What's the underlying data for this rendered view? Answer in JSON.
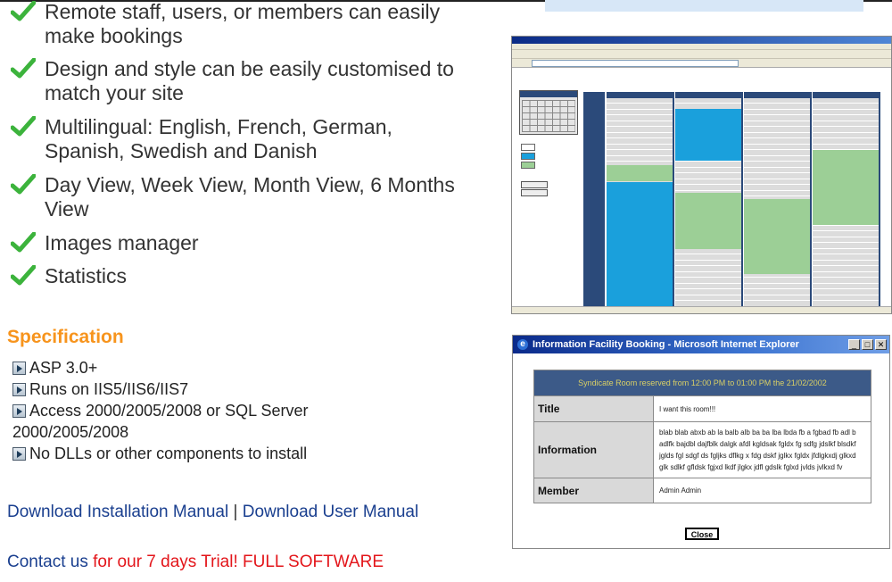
{
  "features": [
    {
      "text": "Remote staff, users, or members can easily make bookings"
    },
    {
      "text": "Design and style can be easily customised to match your site"
    },
    {
      "text": "Multilingual: English, French, German, Spanish, Swedish and Danish"
    },
    {
      "text": "Day View, Week View, Month View, 6 Months View"
    },
    {
      "text": "Images manager"
    },
    {
      "text": "Statistics"
    }
  ],
  "specification": {
    "title": "Specification",
    "items": [
      "ASP 3.0+",
      "Runs on IIS5/IIS6/IIS7",
      "Access 2000/2005/2008 or SQL Server 2000/2005/2008",
      "No DLLs or other components to install"
    ]
  },
  "links": {
    "install_manual": "Download Installation Manual",
    "separator": "|",
    "user_manual": "Download User Manual"
  },
  "contact": {
    "link": "Contact us",
    "trial": " for our 7 days Trial! FULL SOFTWARE"
  },
  "dialog": {
    "window_title": "Information Facility Booking - Microsoft Internet Explorer",
    "banner": "Syndicate Room reserved from 12:00 PM to 01:00 PM the 21/02/2002",
    "title_label": "Title",
    "title_value": "I want this room!!!",
    "info_label": "Information",
    "info_value": "blab blab abxb ab la balb alb ba ba lba lbda fb a fgbad fb adl b adlfk bajdbl dajfblk dalgk afdl kgldsak fgldx fg sdfg jdslkf blsdkf jglds fgl sdgf ds fgljks dflkg x fdg dskf jglkx fgldx jfdlgkxdj glkxd glk sdlkf gfldsk fgjxd lkdf jlgkx jdfl gdslk fglxd jvlds jvlkxd fv",
    "member_label": "Member",
    "member_value": "Admin Admin",
    "close_label": "Close"
  },
  "colors": {
    "accent_orange": "#f7941d",
    "link_blue": "#1a3f8f",
    "trial_red": "#e3151a",
    "check_green": "#3cb33c",
    "reserved_blue": "#1aa0dc",
    "unconfirmed_green": "#9ccf96"
  }
}
